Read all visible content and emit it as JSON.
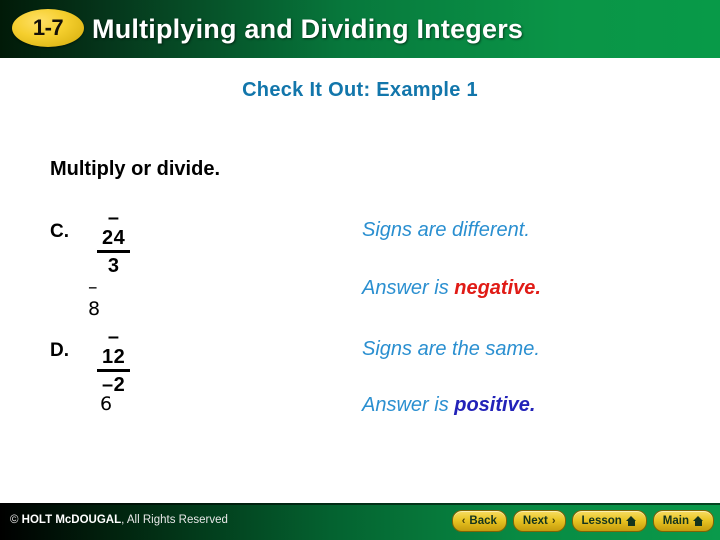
{
  "header": {
    "badge": "1-7",
    "title": "Multiplying and Dividing Integers",
    "colors": {
      "gradient_left": "#011a08",
      "gradient_right": "#089a48",
      "badge_fill": "#f5cf2e",
      "title_color": "#ffffff"
    }
  },
  "slide": {
    "example_title": "Check It Out: Example 1",
    "instruction": "Multiply or divide.",
    "colors": {
      "example_title_color": "#1276ab",
      "callout_color": "#2a8fd0",
      "negative_color": "#e01b16",
      "positive_color": "#2222b8"
    },
    "problems": [
      {
        "label": "C.",
        "numerator": "–24",
        "denominator": "3",
        "answer": "–8",
        "reason": "Signs are different.",
        "conclusion_prefix": "Answer is ",
        "conclusion_emphasis": "negative.",
        "conclusion_sign": "negative"
      },
      {
        "label": "D.",
        "numerator": "–12",
        "denominator": "–2",
        "answer": "6",
        "reason": "Signs are the same.",
        "conclusion_prefix": "Answer is ",
        "conclusion_emphasis": "positive.",
        "conclusion_sign": "positive"
      }
    ]
  },
  "footer": {
    "copyright_symbol": "© ",
    "copyright_brand": "HOLT McDOUGAL",
    "copyright_rest": ", All Rights Reserved",
    "buttons": [
      {
        "label": "Back",
        "icon": "chevron-left-icon",
        "glyph": "‹"
      },
      {
        "label": "Next",
        "icon": "chevron-right-icon",
        "glyph": "›"
      },
      {
        "label": "Lesson",
        "icon": "home-icon",
        "glyph": ""
      },
      {
        "label": "Main",
        "icon": "home-icon",
        "glyph": ""
      }
    ]
  }
}
